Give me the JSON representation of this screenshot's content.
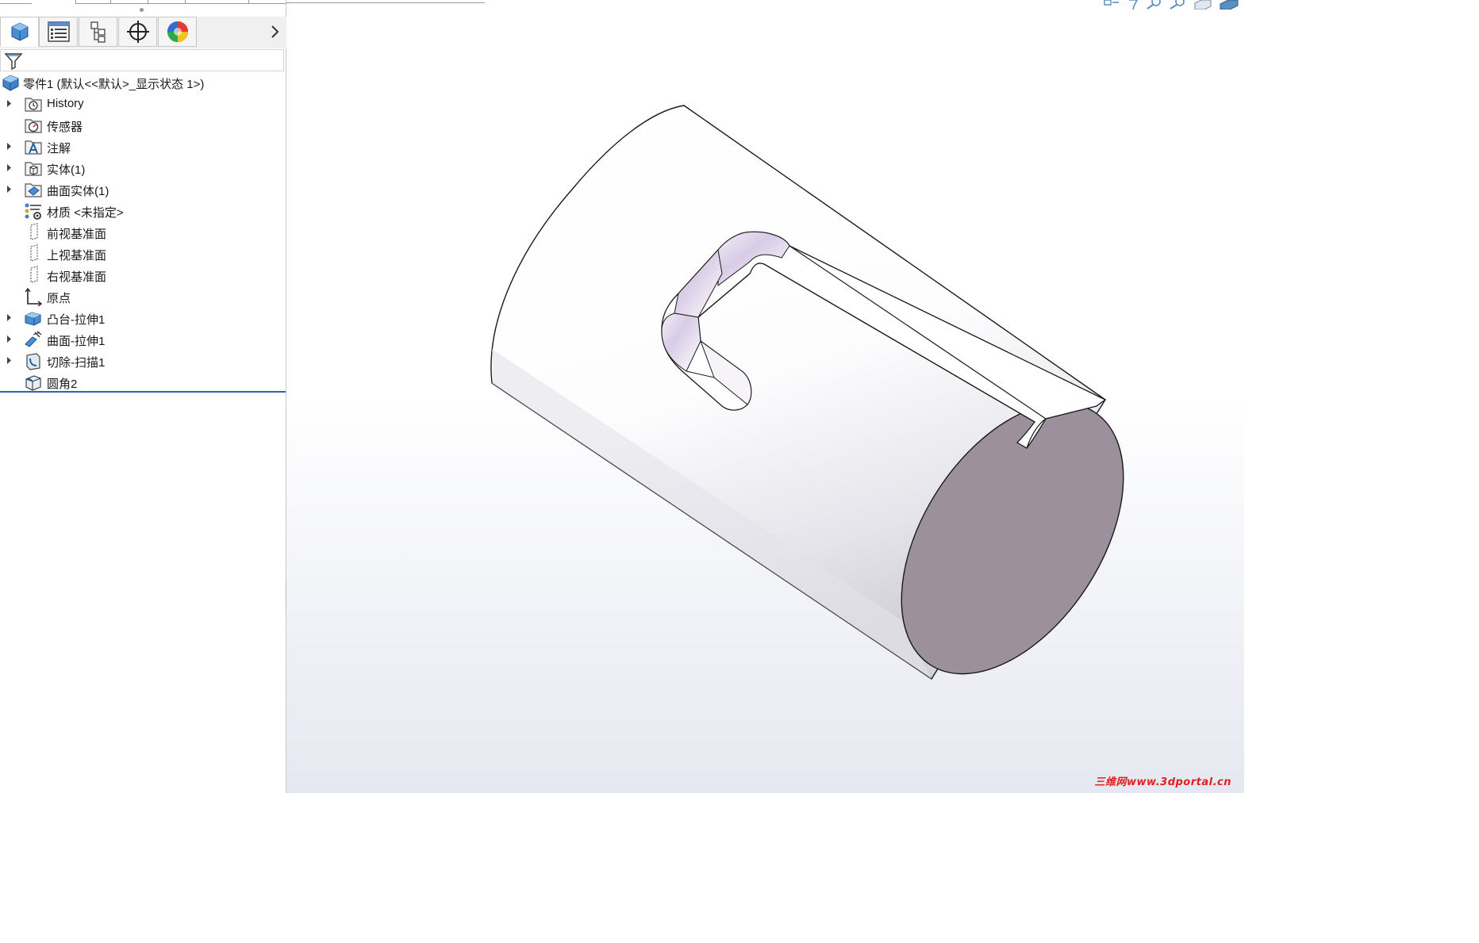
{
  "feature_manager": {
    "tabs": [
      {
        "id": "feature-manager",
        "icon": "feature-manager-icon"
      },
      {
        "id": "property-manager",
        "icon": "property-manager-icon"
      },
      {
        "id": "configuration-manager",
        "icon": "configuration-manager-icon"
      },
      {
        "id": "dimxpert-manager",
        "icon": "crosshair-icon"
      },
      {
        "id": "display-manager",
        "icon": "display-manager-icon"
      }
    ],
    "root": {
      "label": "零件1  (默认<<默认>_显示状态 1>)",
      "icon": "part-icon"
    },
    "items": [
      {
        "label": "History",
        "icon": "history-folder-icon",
        "expandable": true
      },
      {
        "label": "传感器",
        "icon": "sensor-folder-icon",
        "expandable": false
      },
      {
        "label": "注解",
        "icon": "annotations-folder-icon",
        "expandable": true
      },
      {
        "label": "实体(1)",
        "icon": "solid-bodies-folder-icon",
        "expandable": true
      },
      {
        "label": "曲面实体(1)",
        "icon": "surface-bodies-folder-icon",
        "expandable": true
      },
      {
        "label": "材质 <未指定>",
        "icon": "material-icon",
        "expandable": false
      },
      {
        "label": "前视基准面",
        "icon": "plane-icon",
        "expandable": false
      },
      {
        "label": "上视基准面",
        "icon": "plane-icon",
        "expandable": false
      },
      {
        "label": "右视基准面",
        "icon": "plane-icon",
        "expandable": false
      },
      {
        "label": "原点",
        "icon": "origin-icon",
        "expandable": false
      },
      {
        "label": "凸台-拉伸1",
        "icon": "boss-extrude-icon",
        "expandable": true
      },
      {
        "label": "曲面-拉伸1",
        "icon": "surface-extrude-icon",
        "expandable": true
      },
      {
        "label": "切除-扫描1",
        "icon": "cut-sweep-icon",
        "expandable": true
      },
      {
        "label": "圆角2",
        "icon": "fillet-icon",
        "expandable": false
      }
    ]
  },
  "graphics": {
    "watermark": "三维网www.3dportal.cn"
  },
  "colors": {
    "end_face": "#9b909b",
    "rollback_bar": "#2a66b8",
    "watermark": "#e02020"
  }
}
